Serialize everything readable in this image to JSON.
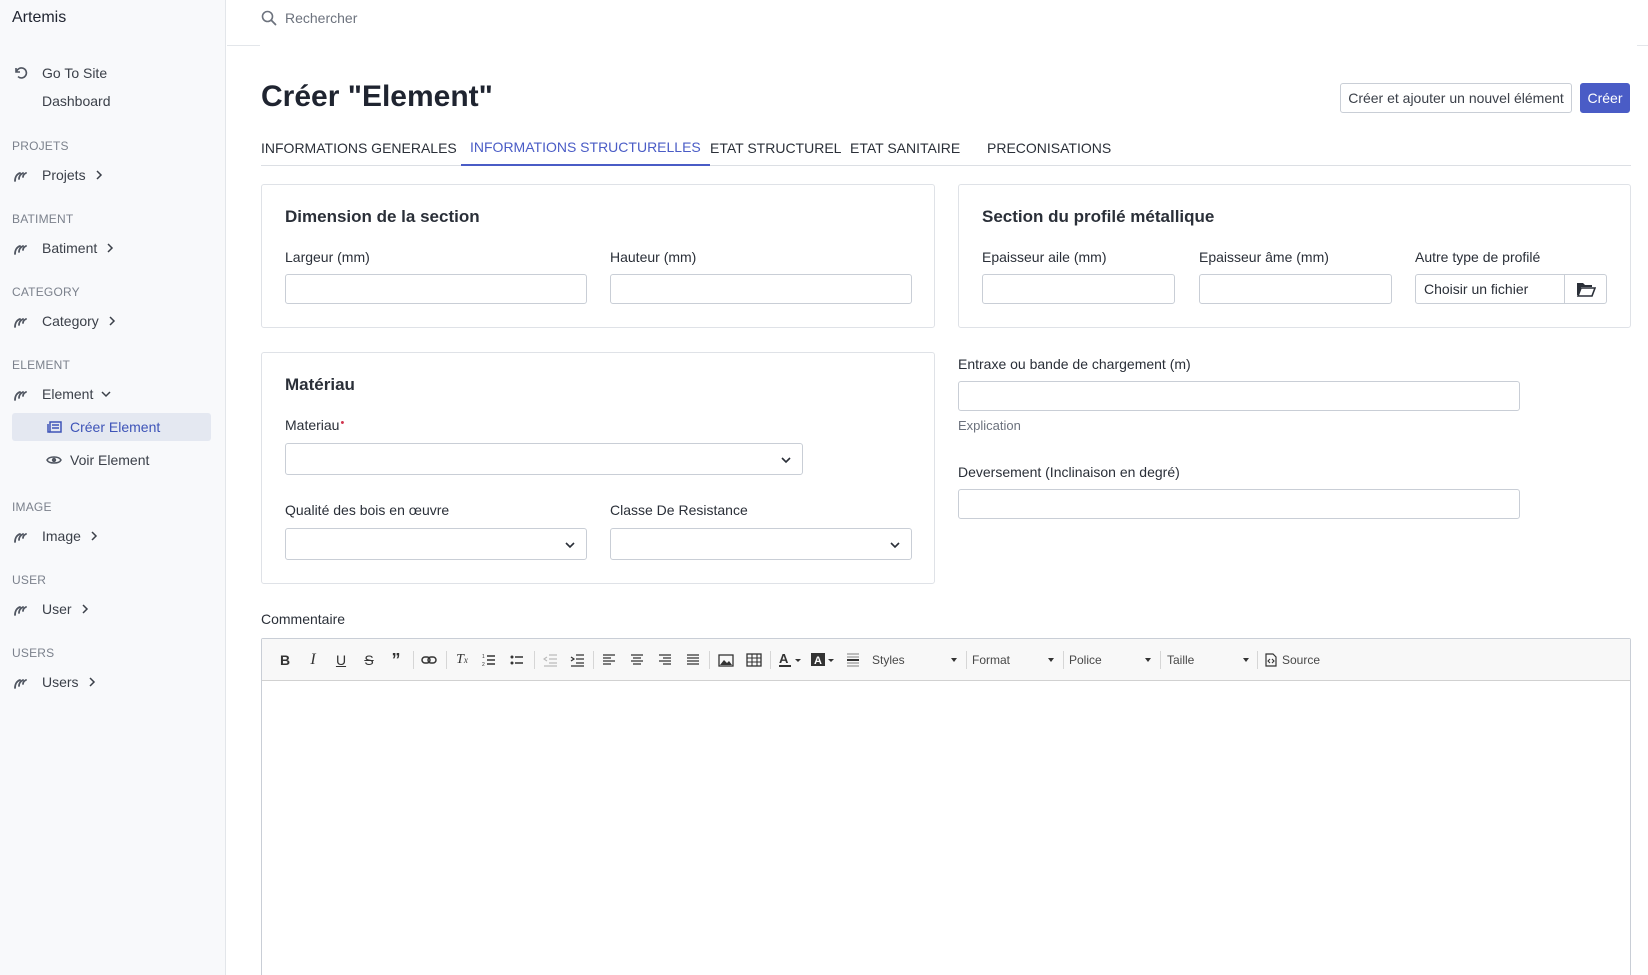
{
  "sidebar": {
    "brand": "Artemis",
    "go_to_site": "Go To Site",
    "dashboard": "Dashboard",
    "sections": [
      {
        "header": "PROJETS",
        "item": "Projets"
      },
      {
        "header": "BATIMENT",
        "item": "Batiment"
      },
      {
        "header": "CATEGORY",
        "item": "Category"
      },
      {
        "header": "ELEMENT",
        "item": "Element"
      },
      {
        "header": "IMAGE",
        "item": "Image"
      },
      {
        "header": "USER",
        "item": "User"
      },
      {
        "header": "USERS",
        "item": "Users"
      }
    ],
    "element_sub": {
      "create": "Créer Element",
      "view": "Voir Element"
    }
  },
  "search": {
    "placeholder": "Rechercher"
  },
  "page": {
    "title": "Créer \"Element\"",
    "btn_create_add": "Créer et ajouter un nouvel élément",
    "btn_create": "Créer"
  },
  "tabs": [
    {
      "label": "INFORMATIONS GENERALES"
    },
    {
      "label": "INFORMATIONS STRUCTURELLES",
      "active": true
    },
    {
      "label": "ETAT STRUCTUREL"
    },
    {
      "label": "ETAT SANITAIRE"
    },
    {
      "label": "PRECONISATIONS"
    }
  ],
  "dimension": {
    "title": "Dimension de la section",
    "largeur": "Largeur (mm)",
    "hauteur": "Hauteur (mm)"
  },
  "profile": {
    "title": "Section du profilé métallique",
    "epaisseur_aile": "Epaisseur aile (mm)",
    "epaisseur_ame": "Epaisseur âme (mm)",
    "autre_type": "Autre type de profilé",
    "file_text": "Choisir un fichier"
  },
  "materiau": {
    "title": "Matériau",
    "materiau_label": "Materiau",
    "required_mark": "•",
    "qualite": "Qualité des bois en œuvre",
    "classe": "Classe De Resistance"
  },
  "entraxe": {
    "label": "Entraxe ou bande de chargement (m)",
    "help": "Explication"
  },
  "deversement": {
    "label": "Deversement (Inclinaison en degré)"
  },
  "commentaire": {
    "label": "Commentaire",
    "combos": {
      "styles": "Styles",
      "format": "Format",
      "police": "Police",
      "taille": "Taille",
      "source": "Source"
    }
  },
  "colors": {
    "accent": "#4a5cc6",
    "required": "#d0364f",
    "sidebar_bg": "#f8f9fb"
  }
}
